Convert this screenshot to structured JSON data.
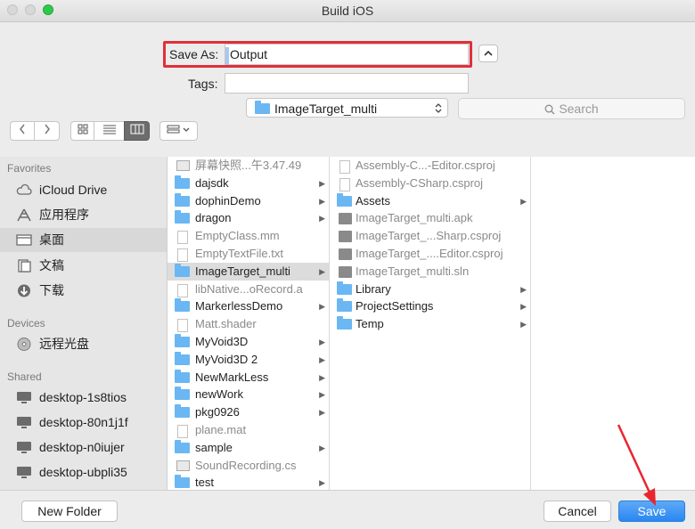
{
  "window": {
    "title": "Build iOS"
  },
  "save_as": {
    "label": "Save As:",
    "value": "Output"
  },
  "tags": {
    "label": "Tags:",
    "value": ""
  },
  "toolbar": {
    "back_icon": "chevron-left-icon",
    "forward_icon": "chevron-right-icon",
    "view_modes": [
      "icon-view",
      "list-view",
      "column-view"
    ],
    "active_view": "column-view",
    "location": "ImageTarget_multi",
    "search_placeholder": "Search"
  },
  "sidebar": {
    "favorites_header": "Favorites",
    "favorites": [
      {
        "label": "iCloud Drive",
        "icon": "cloud-icon"
      },
      {
        "label": "应用程序",
        "icon": "applications-icon"
      },
      {
        "label": "桌面",
        "icon": "desktop-icon",
        "selected": true
      },
      {
        "label": "文稿",
        "icon": "documents-icon"
      },
      {
        "label": "下载",
        "icon": "downloads-icon"
      }
    ],
    "devices_header": "Devices",
    "devices": [
      {
        "label": "远程光盘",
        "icon": "disc-icon"
      }
    ],
    "shared_header": "Shared",
    "shared": [
      {
        "label": "desktop-1s8tios",
        "icon": "computer-icon"
      },
      {
        "label": "desktop-80n1j1f",
        "icon": "computer-icon"
      },
      {
        "label": "desktop-n0iujer",
        "icon": "computer-icon"
      },
      {
        "label": "desktop-ubpli35",
        "icon": "computer-icon"
      }
    ]
  },
  "column1": [
    {
      "name": "屏幕快照...午3.47.49",
      "kind": "image",
      "dim": true
    },
    {
      "name": "dajsdk",
      "kind": "folder"
    },
    {
      "name": "dophinDemo",
      "kind": "folder"
    },
    {
      "name": "dragon",
      "kind": "folder"
    },
    {
      "name": "EmptyClass.mm",
      "kind": "doc",
      "dim": true
    },
    {
      "name": "EmptyTextFile.txt",
      "kind": "doc",
      "dim": true
    },
    {
      "name": "ImageTarget_multi",
      "kind": "folder",
      "selected": true
    },
    {
      "name": "libNative...oRecord.a",
      "kind": "doc",
      "dim": true
    },
    {
      "name": "MarkerlessDemo",
      "kind": "folder"
    },
    {
      "name": "Matt.shader",
      "kind": "doc",
      "dim": true
    },
    {
      "name": "MyVoid3D",
      "kind": "folder"
    },
    {
      "name": "MyVoid3D 2",
      "kind": "folder"
    },
    {
      "name": "NewMarkLess",
      "kind": "folder"
    },
    {
      "name": "newWork",
      "kind": "folder"
    },
    {
      "name": "pkg0926",
      "kind": "folder"
    },
    {
      "name": "plane.mat",
      "kind": "doc",
      "dim": true
    },
    {
      "name": "sample",
      "kind": "folder"
    },
    {
      "name": "SoundRecording.cs",
      "kind": "image",
      "dim": true
    },
    {
      "name": "test",
      "kind": "folder"
    }
  ],
  "column2": [
    {
      "name": "Assembly-C...-Editor.csproj",
      "kind": "doc",
      "dim": true
    },
    {
      "name": "Assembly-CSharp.csproj",
      "kind": "doc",
      "dim": true
    },
    {
      "name": "Assets",
      "kind": "folder"
    },
    {
      "name": "ImageTarget_multi.apk",
      "kind": "gray",
      "dim": true
    },
    {
      "name": "ImageTarget_...Sharp.csproj",
      "kind": "gray",
      "dim": true
    },
    {
      "name": "ImageTarget_....Editor.csproj",
      "kind": "gray",
      "dim": true
    },
    {
      "name": "ImageTarget_multi.sln",
      "kind": "gray",
      "dim": true
    },
    {
      "name": "Library",
      "kind": "folder"
    },
    {
      "name": "ProjectSettings",
      "kind": "folder"
    },
    {
      "name": "Temp",
      "kind": "folder"
    }
  ],
  "buttons": {
    "new_folder": "New Folder",
    "cancel": "Cancel",
    "save": "Save"
  },
  "colors": {
    "highlight": "#e0303a",
    "accent": "#2a87f1",
    "folder": "#6ab7f3"
  }
}
